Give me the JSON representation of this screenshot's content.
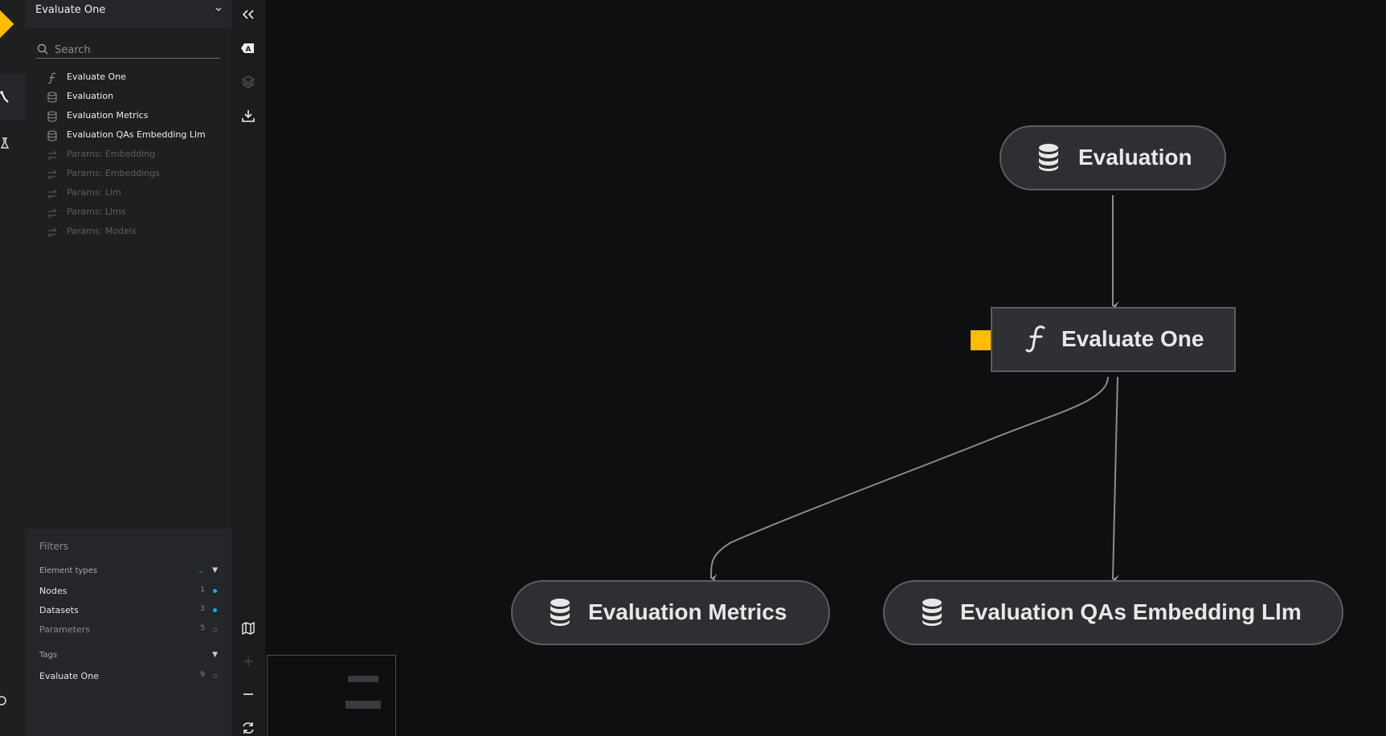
{
  "app": {
    "pipeline": "Evaluate One",
    "search_placeholder": "Search"
  },
  "tree": [
    {
      "label": "Evaluate One",
      "icon": "function-icon",
      "state": "on"
    },
    {
      "label": "Evaluation",
      "icon": "database-icon",
      "state": "on"
    },
    {
      "label": "Evaluation Metrics",
      "icon": "database-icon",
      "state": "on"
    },
    {
      "label": "Evaluation QAs Embedding Llm",
      "icon": "database-icon",
      "state": "on"
    },
    {
      "label": "Params: Embedding",
      "icon": "params-icon",
      "state": "off"
    },
    {
      "label": "Params: Embeddings",
      "icon": "params-icon",
      "state": "off"
    },
    {
      "label": "Params: Llm",
      "icon": "params-icon",
      "state": "off"
    },
    {
      "label": "Params: Llms",
      "icon": "params-icon",
      "state": "off"
    },
    {
      "label": "Params: Models",
      "icon": "params-icon",
      "state": "off"
    }
  ],
  "filters": {
    "title": "Filters",
    "element_types_label": "Element types",
    "element_types_toggle": "–",
    "rows": [
      {
        "label": "Nodes",
        "count": "1",
        "checked": true
      },
      {
        "label": "Datasets",
        "count": "3",
        "checked": true
      },
      {
        "label": "Parameters",
        "count": "5",
        "checked": false
      }
    ],
    "tags_label": "Tags",
    "tag_rows": [
      {
        "label": "Evaluate One",
        "count": "9",
        "checked": false
      }
    ]
  },
  "graph": {
    "nodes": [
      {
        "id": "evaluation",
        "label": "Evaluation",
        "kind": "dataset"
      },
      {
        "id": "evaluate_one",
        "label": "Evaluate One",
        "kind": "function",
        "tagged": true
      },
      {
        "id": "evaluation_metrics",
        "label": "Evaluation Metrics",
        "kind": "dataset"
      },
      {
        "id": "evaluation_qas",
        "label": "Evaluation QAs Embedding Llm",
        "kind": "dataset"
      }
    ],
    "edges": [
      {
        "from": "evaluation",
        "to": "evaluate_one"
      },
      {
        "from": "evaluate_one",
        "to": "evaluation_metrics"
      },
      {
        "from": "evaluate_one",
        "to": "evaluation_qas"
      }
    ]
  },
  "colors": {
    "accent": "#ffbc00",
    "filter_on": "#00b0f5"
  }
}
